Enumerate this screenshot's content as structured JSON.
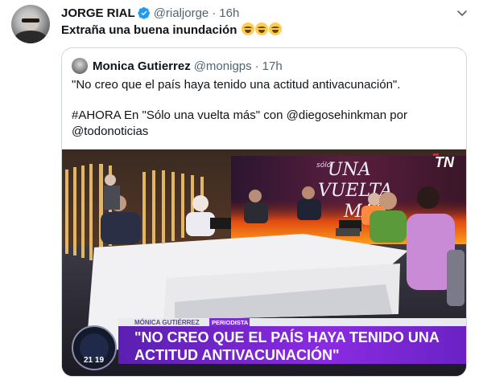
{
  "tweet": {
    "author_name": "JORGE RIAL",
    "author_handle": "@rialjorge",
    "separator": "·",
    "time": "16h",
    "text": "Extraña una buena inundación",
    "emoji_count": 3,
    "verified": true,
    "icons": {
      "verified": "verified-badge-icon",
      "more": "chevron-down-icon",
      "emoji": "rolling-on-floor-laughing-emoji"
    }
  },
  "quoted_tweet": {
    "author_name": "Monica Gutierrez",
    "author_handle": "@monigps",
    "separator": "·",
    "time": "17h",
    "line1": "\"No creo que el país haya tenido una actitud antivacunación\".",
    "line2": "#AHORA En \"Sólo una vuelta más\" con @diegosehinkman por",
    "line3": "@todonoticias",
    "media": {
      "channel_logo": "TN",
      "set_sign": "SOLO UNA VUELTA MAS",
      "lower_third_name": "MÓNICA GUTIÉRREZ",
      "lower_third_role": "PERIODISTA",
      "headline_line1": "\"NO CREO QUE EL PAÍS HAYA TENIDO UNA",
      "headline_line2": "ACTITUD ANTIVACUNACIÓN\"",
      "clock": "21 19"
    }
  },
  "colors": {
    "name": "#0f1419",
    "secondary": "#536471",
    "verified": "#1d9bf0",
    "border": "#cfd9de",
    "lower_third_purple": "#7b2fd0",
    "tn_red": "#e3232a"
  }
}
